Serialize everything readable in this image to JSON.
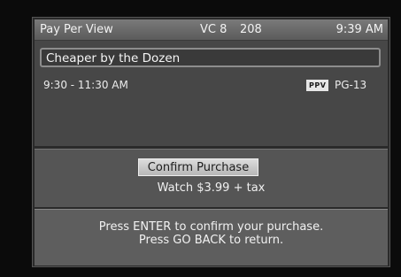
{
  "header": {
    "title": "Pay Per View",
    "channel": "VC 8",
    "channel_number": "208",
    "clock": "9:39 AM"
  },
  "program": {
    "title": "Cheaper by the Dozen",
    "time": "9:30 - 11:30 AM",
    "badge": "PPV",
    "rating": "PG-13"
  },
  "purchase": {
    "confirm_label": "Confirm Purchase",
    "price_line": "Watch $3.99 + tax"
  },
  "instructions": {
    "line1": "Press ENTER to confirm your purchase.",
    "line2": "Press GO BACK to return."
  },
  "colors": {
    "background": "#0b0b0b",
    "header": "#6a6a6a",
    "panel": "#474747",
    "button": "#c9c9c9"
  }
}
